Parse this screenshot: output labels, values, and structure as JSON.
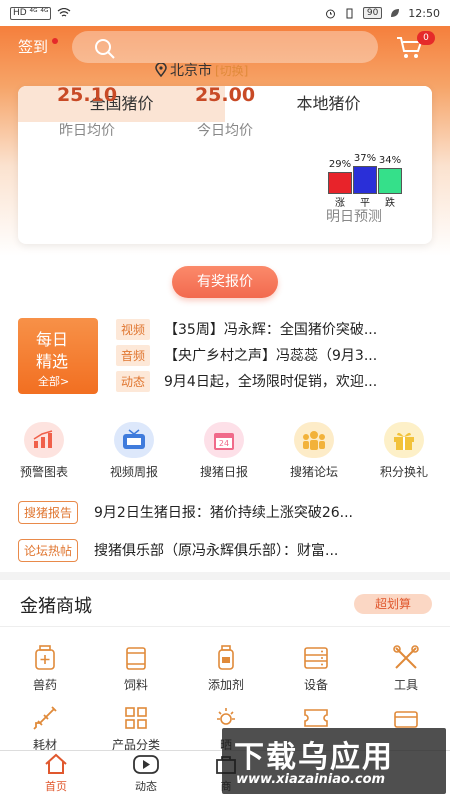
{
  "status": {
    "left_icons": "HD ⁴ᴳ ⁴ᴳ",
    "battery": "90",
    "time": "12:50"
  },
  "header": {
    "sign_in": "签到",
    "cart_badge": "0"
  },
  "price_card": {
    "tabs": [
      "全国猪价",
      "本地猪价"
    ],
    "location": "北京市",
    "switch_label": "[切换]",
    "yesterday_value": "25.10",
    "yesterday_label": "昨日均价",
    "today_value": "25.00",
    "today_label": "今日均价",
    "predict_label": "明日预测",
    "prediction": [
      {
        "pct_text": "29%",
        "label": "涨",
        "value": 29,
        "color": "#e8232a"
      },
      {
        "pct_text": "37%",
        "label": "平",
        "value": 37,
        "color": "#2a2fd8"
      },
      {
        "pct_text": "34%",
        "label": "跌",
        "value": 34,
        "color": "#35e08a"
      }
    ]
  },
  "reward_button": "有奖报价",
  "daily": {
    "line1": "每日",
    "line2": "精选",
    "all": "全部>"
  },
  "news": [
    {
      "tag": "视频",
      "text": "【35周】冯永辉：全国猪价突破..."
    },
    {
      "tag": "音频",
      "text": "【央广乡村之声】冯蕊蕊（9月3..."
    },
    {
      "tag": "动态",
      "text": "9月4日起，全场限时促销，欢迎..."
    }
  ],
  "quick": [
    {
      "label": "预警图表",
      "icon": "chart-icon",
      "color": "#f0604a"
    },
    {
      "label": "视频周报",
      "icon": "tv-icon",
      "color": "#3f7bdc"
    },
    {
      "label": "搜猪日报",
      "icon": "calendar-icon",
      "color": "#f06a8a"
    },
    {
      "label": "搜猪论坛",
      "icon": "people-icon",
      "color": "#f2b23a"
    },
    {
      "label": "积分换礼",
      "icon": "gift-icon",
      "color": "#f2c23a"
    }
  ],
  "reports": [
    {
      "tag": "搜猪报告",
      "text": "9月2日生猪日报：猪价持续上涨突破26..."
    },
    {
      "tag": "论坛热帖",
      "text": "搜猪俱乐部（原冯永辉俱乐部）：财富..."
    }
  ],
  "mall": {
    "title": "金猪商城",
    "super": "超划算",
    "categories": [
      {
        "label": "兽药",
        "icon": "medicine-bottle-icon"
      },
      {
        "label": "饲料",
        "icon": "feed-icon"
      },
      {
        "label": "添加剂",
        "icon": "bottle-icon"
      },
      {
        "label": "设备",
        "icon": "equipment-icon"
      },
      {
        "label": "工具",
        "icon": "tools-icon"
      },
      {
        "label": "耗材",
        "icon": "syringe-icon"
      },
      {
        "label": "产品分类",
        "icon": "grid-icon"
      },
      {
        "label": "晒",
        "icon": "sun-icon"
      },
      {
        "label": "",
        "icon": "coupon-icon"
      },
      {
        "label": "",
        "icon": "box-icon"
      }
    ]
  },
  "tabbar": [
    {
      "label": "首页",
      "icon": "home-icon"
    },
    {
      "label": "动态",
      "icon": "play-icon"
    },
    {
      "label": "商",
      "icon": "shop-icon"
    }
  ],
  "watermark": {
    "line1": "下载乌应用",
    "line2": "www.xiazainiao.com"
  }
}
